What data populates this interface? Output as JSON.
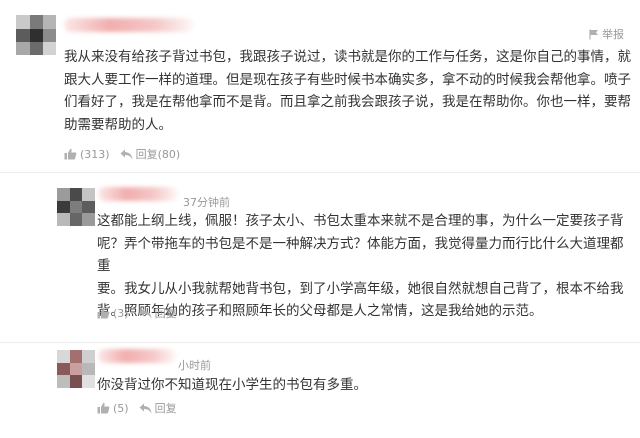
{
  "report": {
    "label": "举报"
  },
  "comments": [
    {
      "timestamp": "",
      "text": "我从来没有给孩子背过书包，我跟孩子说过，读书就是你的工作与任务，这是你自己的事情，就\n跟大人要工作一样的道理。但是现在孩子有些时候书本确实多，拿不动的时候我会帮他拿。喷子\n们看好了，我是在帮他拿而不是背。而且拿之前我会跟孩子说，我是在帮助你。你也一样，要帮\n助需要帮助的人。",
      "likes": "(313)",
      "replies_label": "回复(80)"
    },
    {
      "timestamp": "37分钟前",
      "text": "这都能上纲上线，佩服！孩子太小、书包太重本来就不是合理的事，为什么一定要孩子背\n呢？弄个带拖车的书包是不是一种解决方式？体能方面，我觉得量力而行比什么大道理都重\n要。我女儿从小我就帮她背书包，到了小学高年级，她很自然就想自己背了，根本不给我\n背。照顾年幼的孩子和照顾年长的父母都是人之常情，这是我给她的示范。",
      "likes": "(3)",
      "replies_label": "回复"
    },
    {
      "timestamp": "小时前",
      "text": "你没背过你不知道现在小学生的书包有多重。",
      "likes": "(5)",
      "replies_label": "回复"
    }
  ],
  "colors": {
    "text": "#333333",
    "meta": "#999999",
    "username_blur": "#f0aaaa",
    "icon": "#b0b0b0"
  }
}
